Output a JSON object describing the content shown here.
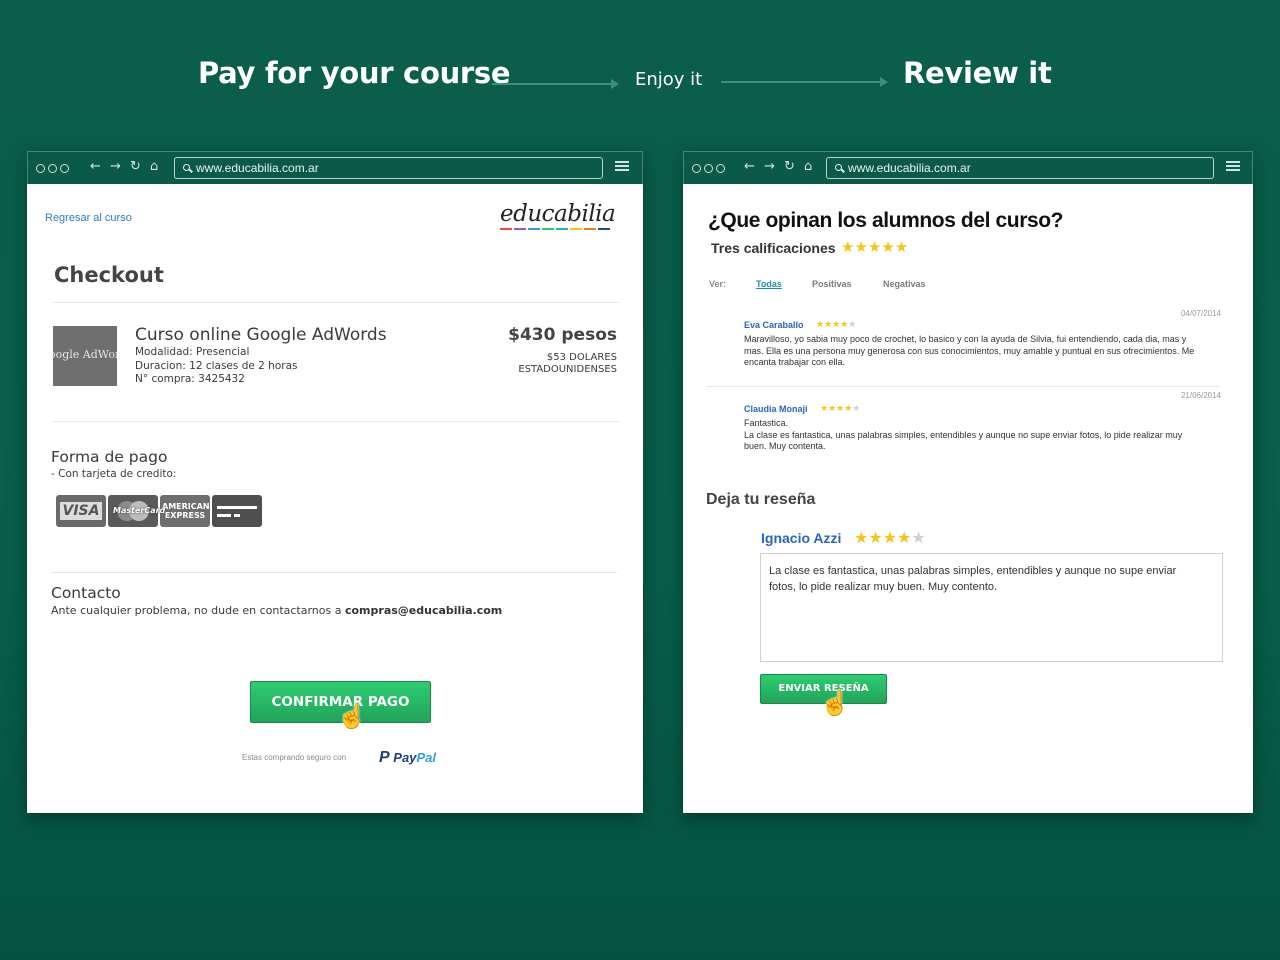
{
  "flow": {
    "step1": "Pay for your course",
    "step2": "Enjoy it",
    "step3": "Review it"
  },
  "left_window": {
    "url": "www.educabilia.com.ar",
    "back_link": "Regresar al curso",
    "logo": "educabilia",
    "title": "Checkout",
    "course": {
      "thumb_text": "oogle AdWord",
      "name": "Curso online Google AdWords",
      "modalidad": "Modalidad: Presencial",
      "duracion": "Duracion: 12 clases de 2 horas",
      "compra": "N° compra: 3425432",
      "price": "$430 pesos",
      "price_usd_1": "$53 DOLARES",
      "price_usd_2": "ESTADOUNIDENSES"
    },
    "payment": {
      "title": "Forma de pago",
      "subtitle": "- Con tarjeta de credito:",
      "cards": [
        "VISA",
        "MasterCard",
        "AMERICAN EXPRESS",
        "generic-card"
      ]
    },
    "contact": {
      "title": "Contacto",
      "text": "Ante cualquier problema, no dude en contactarnos a ",
      "email": "compras@educabilia.com"
    },
    "confirm_button": "CONFIRMAR PAGO",
    "secure_text": "Estas comprando seguro con",
    "paypal_pay": "Pay",
    "paypal_pal": "Pal"
  },
  "right_window": {
    "url": "www.educabilia.com.ar",
    "title": "¿Que opinan los alumnos del curso?",
    "subtitle": "Tres calificaciones",
    "rating_overall": 5,
    "filter_label": "Ver:",
    "tabs": [
      "Todas",
      "Positivas",
      "Negativas"
    ],
    "reviews": [
      {
        "date": "04/07/2014",
        "name": "Eva Caraballo",
        "rating": 4,
        "line1": "Maravilloso, yo sabia muy poco de crochet, lo basico y con la ayuda de Silvia, fui entendiendo, cada dia, mas y",
        "line2": "mas. Ella es una persona muy generosa con sus conocimientos, muy amable y puntual en sus ofrecimientos. Me",
        "line3": "encanta trabajar con ella."
      },
      {
        "date": "21/06/2014",
        "name": "Claudia Monaji",
        "rating": 4,
        "line1": "Fantastica.",
        "line2": "La clase es fantastica, unas palabras simples, entendibles y aunque no supe enviar fotos, lo pide realizar muy",
        "line3": "buen. Muy contenta."
      }
    ],
    "leave_review": {
      "title": "Deja tu reseña",
      "user": "Ignacio Azzi",
      "rating": 4,
      "text_line1": "La clase es fantastica, unas palabras simples, entendibles y aunque no supe enviar",
      "text_line2": "fotos, lo pide realizar muy buen. Muy contento.",
      "button": "ENVIAR RESEÑA"
    }
  },
  "colors": {
    "background": "#075f4a",
    "chrome": "#0a5a47",
    "button_green": "#27ae60",
    "link_blue": "#2764c4",
    "star": "#f5c518"
  }
}
